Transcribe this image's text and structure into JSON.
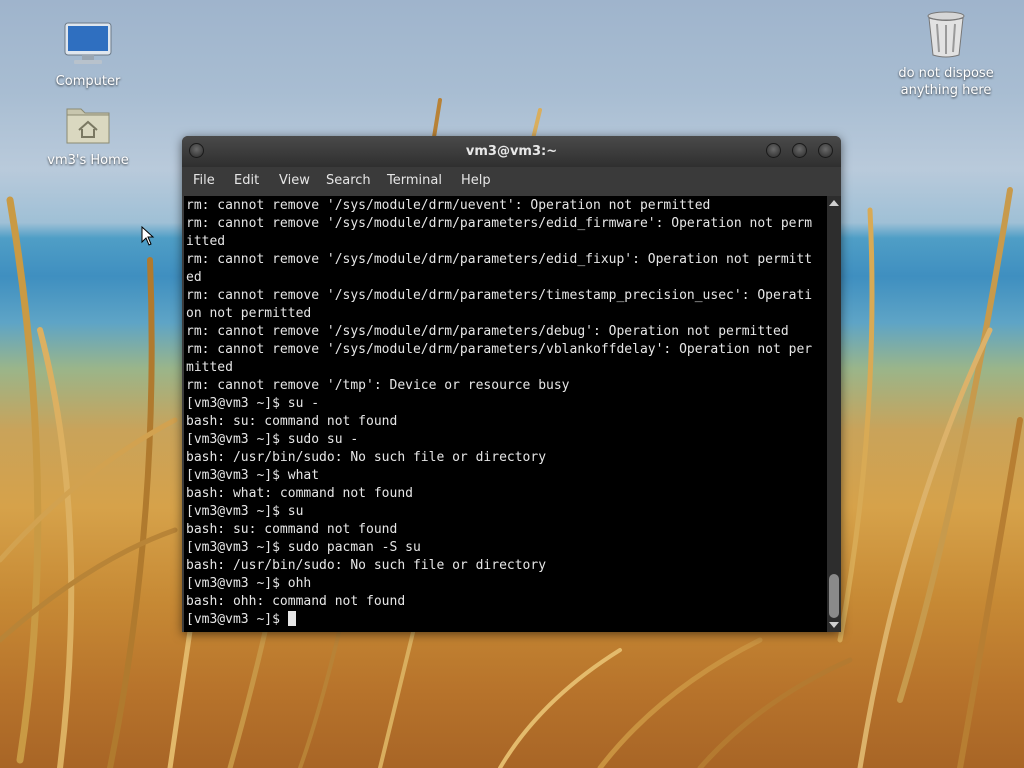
{
  "desktop": {
    "icons": [
      {
        "label": "Computer"
      },
      {
        "label": "vm3's Home"
      },
      {
        "label": "do not dispose anything here"
      }
    ]
  },
  "terminal": {
    "title": "vm3@vm3:~",
    "menu": [
      "File",
      "Edit",
      "View",
      "Search",
      "Terminal",
      "Help"
    ],
    "lines": [
      "rm: cannot remove '/sys/module/drm/uevent': Operation not permitted",
      "rm: cannot remove '/sys/module/drm/parameters/edid_firmware': Operation not perm",
      "itted",
      "rm: cannot remove '/sys/module/drm/parameters/edid_fixup': Operation not permitt",
      "ed",
      "rm: cannot remove '/sys/module/drm/parameters/timestamp_precision_usec': Operati",
      "on not permitted",
      "rm: cannot remove '/sys/module/drm/parameters/debug': Operation not permitted",
      "rm: cannot remove '/sys/module/drm/parameters/vblankoffdelay': Operation not per",
      "mitted",
      "rm: cannot remove '/tmp': Device or resource busy",
      "[vm3@vm3 ~]$ su -",
      "bash: su: command not found",
      "[vm3@vm3 ~]$ sudo su -",
      "bash: /usr/bin/sudo: No such file or directory",
      "[vm3@vm3 ~]$ what",
      "bash: what: command not found",
      "[vm3@vm3 ~]$ su",
      "bash: su: command not found",
      "[vm3@vm3 ~]$ sudo pacman -S su",
      "bash: /usr/bin/sudo: No such file or directory",
      "[vm3@vm3 ~]$ ohh",
      "bash: ohh: command not found"
    ],
    "prompt": "[vm3@vm3 ~]$ "
  },
  "icons": [
    "computer-icon",
    "home-folder-icon",
    "trash-icon",
    "mouse-pointer-icon"
  ]
}
